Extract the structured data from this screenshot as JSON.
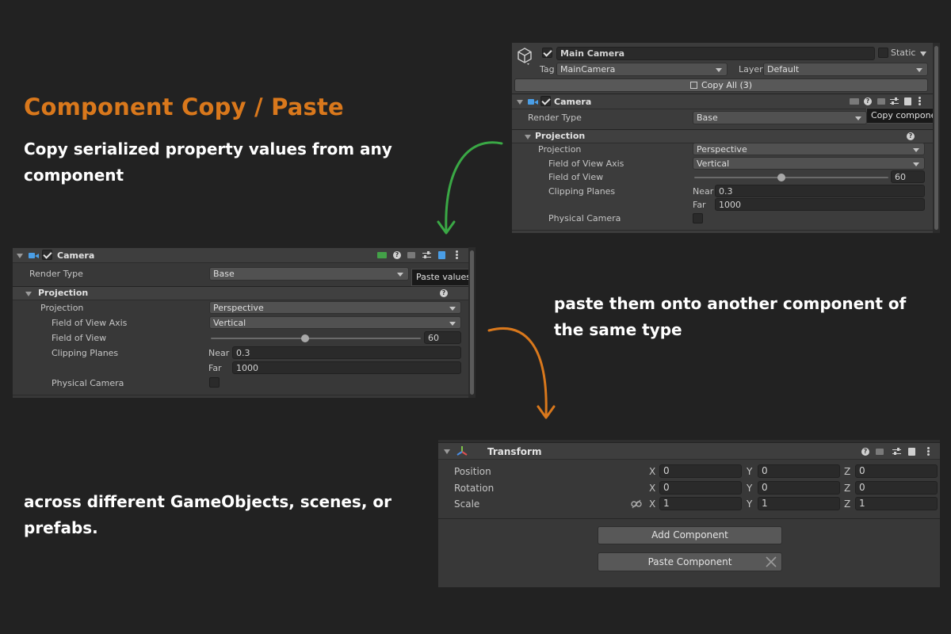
{
  "slide": {
    "title": "Component Copy / Paste",
    "caption_copy": "Copy serialized property values from any component",
    "caption_paste": "paste them onto another component of the same type",
    "caption_across": "across different GameObjects, scenes, or prefabs."
  },
  "colors": {
    "title": "#d9781c",
    "arrow_green": "#3aa845",
    "arrow_orange": "#d9781c",
    "camera_icon": "#4a9ee6"
  },
  "source_inspector": {
    "object_name": "Main Camera",
    "static_label": "Static",
    "tag_label": "Tag",
    "tag_value": "MainCamera",
    "layer_label": "Layer",
    "layer_value": "Default",
    "copy_all_label": "Copy All (3)",
    "component_title": "Camera",
    "tooltip": "Copy component",
    "render_type_label": "Render Type",
    "render_type_value": "Base",
    "section_projection": "Projection",
    "projection_label": "Projection",
    "projection_value": "Perspective",
    "fov_axis_label": "Field of View Axis",
    "fov_axis_value": "Vertical",
    "fov_label": "Field of View",
    "fov_value": "60",
    "fov_fraction": 0.45,
    "clipping_label": "Clipping Planes",
    "near_label": "Near",
    "near_value": "0.3",
    "far_label": "Far",
    "far_value": "1000",
    "physical_label": "Physical Camera"
  },
  "target_inspector": {
    "component_title": "Camera",
    "tooltip": "Paste values",
    "render_type_label": "Render Type",
    "render_type_value": "Base",
    "section_projection": "Projection",
    "projection_label": "Projection",
    "projection_value": "Perspective",
    "fov_axis_label": "Field of View Axis",
    "fov_axis_value": "Vertical",
    "fov_label": "Field of View",
    "fov_value": "60",
    "fov_fraction": 0.45,
    "clipping_label": "Clipping Planes",
    "near_label": "Near",
    "near_value": "0.3",
    "far_label": "Far",
    "far_value": "1000",
    "physical_label": "Physical Camera"
  },
  "transform_inspector": {
    "component_title": "Transform",
    "rows": [
      {
        "label": "Position",
        "x": "0",
        "y": "0",
        "z": "0"
      },
      {
        "label": "Rotation",
        "x": "0",
        "y": "0",
        "z": "0"
      },
      {
        "label": "Scale",
        "x": "1",
        "y": "1",
        "z": "1"
      }
    ],
    "axis_x": "X",
    "axis_y": "Y",
    "axis_z": "Z",
    "add_component_label": "Add Component",
    "paste_component_label": "Paste Component"
  }
}
